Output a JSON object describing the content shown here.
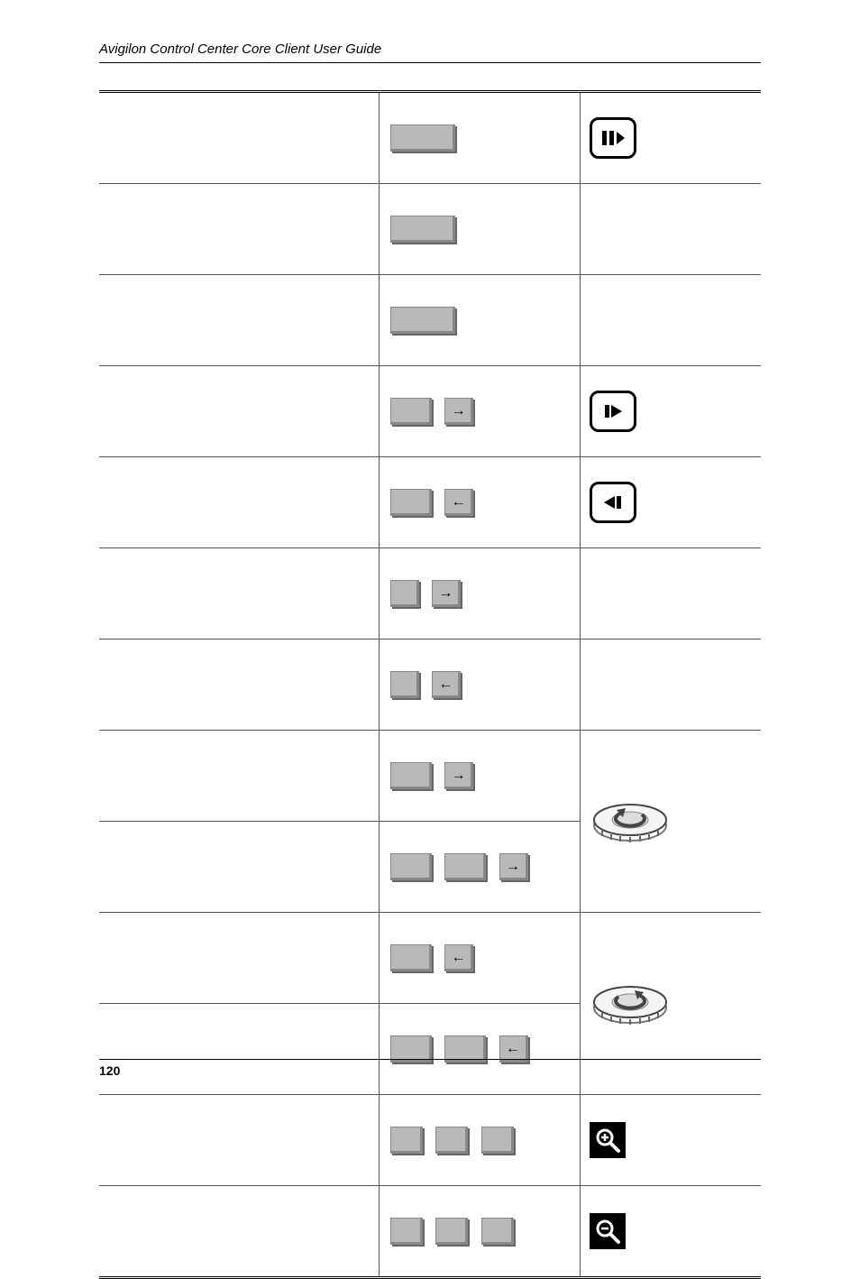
{
  "header": {
    "title": "Avigilon Control Center Core Client User Guide"
  },
  "footer": {
    "page_number": "120"
  },
  "keys": {
    "arrow_right": "→",
    "arrow_left": "←"
  },
  "icons": {
    "pause_play": "pause-play-icon",
    "play_fwd": "play-forward-icon",
    "play_back": "play-backward-icon",
    "shuttle_ccw": "shuttle-ccw-icon",
    "shuttle_cw": "shuttle-cw-icon",
    "zoom_in": "zoom-in-icon",
    "zoom_out": "zoom-out-icon"
  }
}
